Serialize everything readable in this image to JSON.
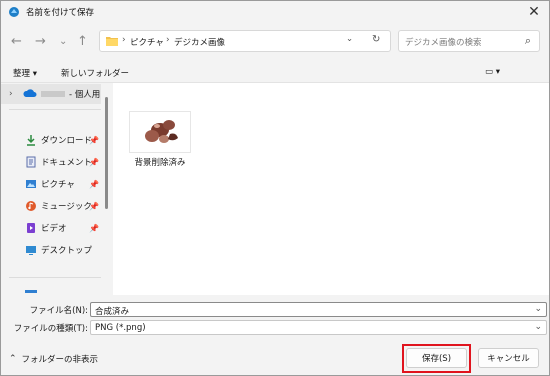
{
  "window": {
    "title": "名前を付けて保存",
    "close_icon": "✕"
  },
  "nav": {
    "back": "←",
    "forward": "→",
    "dropdown": "⌄",
    "up": "↑"
  },
  "address": {
    "crumbs": [
      "ピクチャ",
      "デジカメ画像"
    ],
    "separator": "›",
    "chevron": "⌄",
    "refresh": "↻"
  },
  "search": {
    "placeholder": "デジカメ画像の検索",
    "icon": "⌕"
  },
  "toolbar": {
    "organize": "整理 ▾",
    "new_folder": "新しいフォルダー",
    "view": "▭ ▾"
  },
  "sidebar": {
    "onedrive_suffix": "- 個人用",
    "expander": "›",
    "pin": "📌",
    "items": [
      {
        "label": "ダウンロード",
        "icon": "download-icon",
        "color": "#2b8a3e"
      },
      {
        "label": "ドキュメント",
        "icon": "document-icon",
        "color": "#5b6ea8"
      },
      {
        "label": "ピクチャ",
        "icon": "pictures-icon",
        "color": "#2f7fd1"
      },
      {
        "label": "ミュージック",
        "icon": "music-icon",
        "color": "#e05a2b"
      },
      {
        "label": "ビデオ",
        "icon": "video-icon",
        "color": "#7b3fd1"
      },
      {
        "label": "デスクトップ",
        "icon": "desktop-icon",
        "color": "#2f8ad1"
      }
    ]
  },
  "files": [
    {
      "name": "背景削除済み"
    }
  ],
  "form": {
    "filename_label": "ファイル名(N):",
    "filename_value": "合成済み",
    "filetype_label": "ファイルの種類(T):",
    "filetype_value": "PNG (*.png)",
    "chevron": "⌄"
  },
  "footer": {
    "hide_folders": "フォルダーの非表示",
    "hide_icon": "⌃",
    "save": "保存(S)",
    "cancel": "キャンセル",
    "highlight_color": "#e0141e"
  }
}
